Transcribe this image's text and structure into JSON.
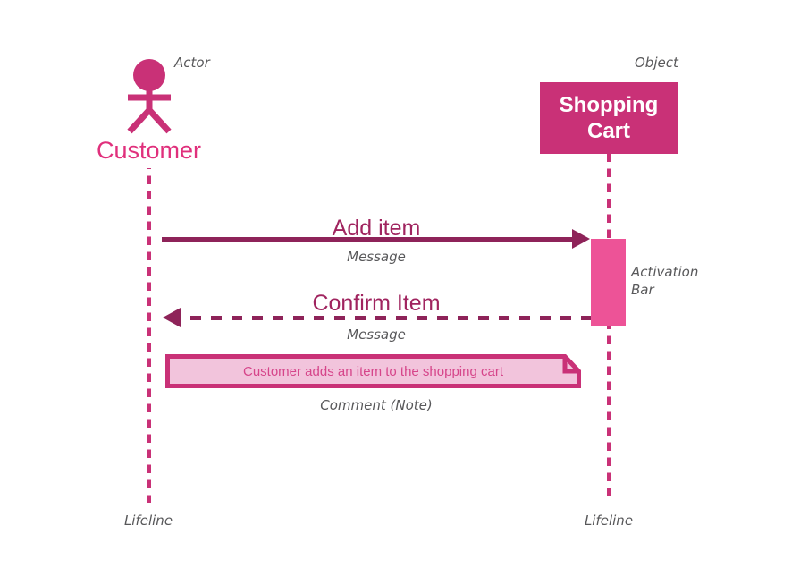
{
  "diagram": {
    "type": "uml-sequence-diagram",
    "background_color": "#ffffff",
    "colors": {
      "primary_pink": "#c93177",
      "bright_pink": "#e0307c",
      "activation_pink": "#ed5397",
      "dark_magenta": "#8e2359",
      "message_label": "#a0245f",
      "note_fill": "#f2c4dc",
      "note_text": "#d6458a",
      "annotation_gray": "#58585a",
      "object_text": "#ffffff"
    }
  },
  "participants": {
    "actor": {
      "annotation": "Actor",
      "name": "Customer",
      "icon": "actor-stick-figure",
      "lifeline_label": "Lifeline"
    },
    "object": {
      "annotation": "Object",
      "name": "Shopping\nCart",
      "lifeline_label": "Lifeline",
      "activation_annotation": "Activation\nBar"
    }
  },
  "messages": [
    {
      "label": "Add item",
      "annotation": "Message",
      "style": "solid",
      "direction": "right",
      "from": "actor",
      "to": "object"
    },
    {
      "label": "Confirm Item",
      "annotation": "Message",
      "style": "dashed",
      "direction": "left",
      "from": "object",
      "to": "actor"
    }
  ],
  "note": {
    "text": "Customer adds an item to the shopping cart",
    "annotation": "Comment (Note)"
  }
}
